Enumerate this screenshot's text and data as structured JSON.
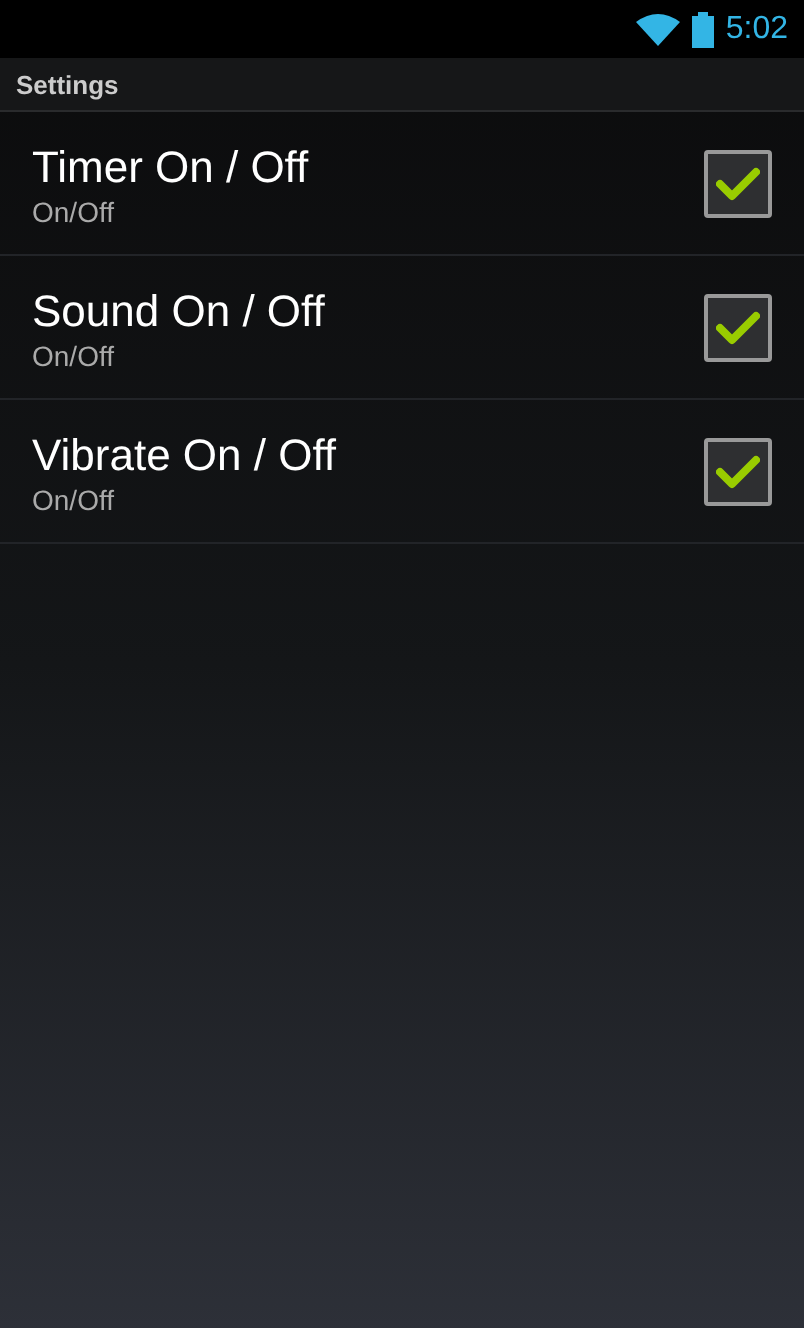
{
  "status_bar": {
    "time": "5:02"
  },
  "section_header": "Settings",
  "settings": [
    {
      "title": "Timer On / Off",
      "summary": "On/Off",
      "checked": true
    },
    {
      "title": "Sound On / Off",
      "summary": "On/Off",
      "checked": true
    },
    {
      "title": "Vibrate On / Off",
      "summary": "On/Off",
      "checked": true
    }
  ]
}
